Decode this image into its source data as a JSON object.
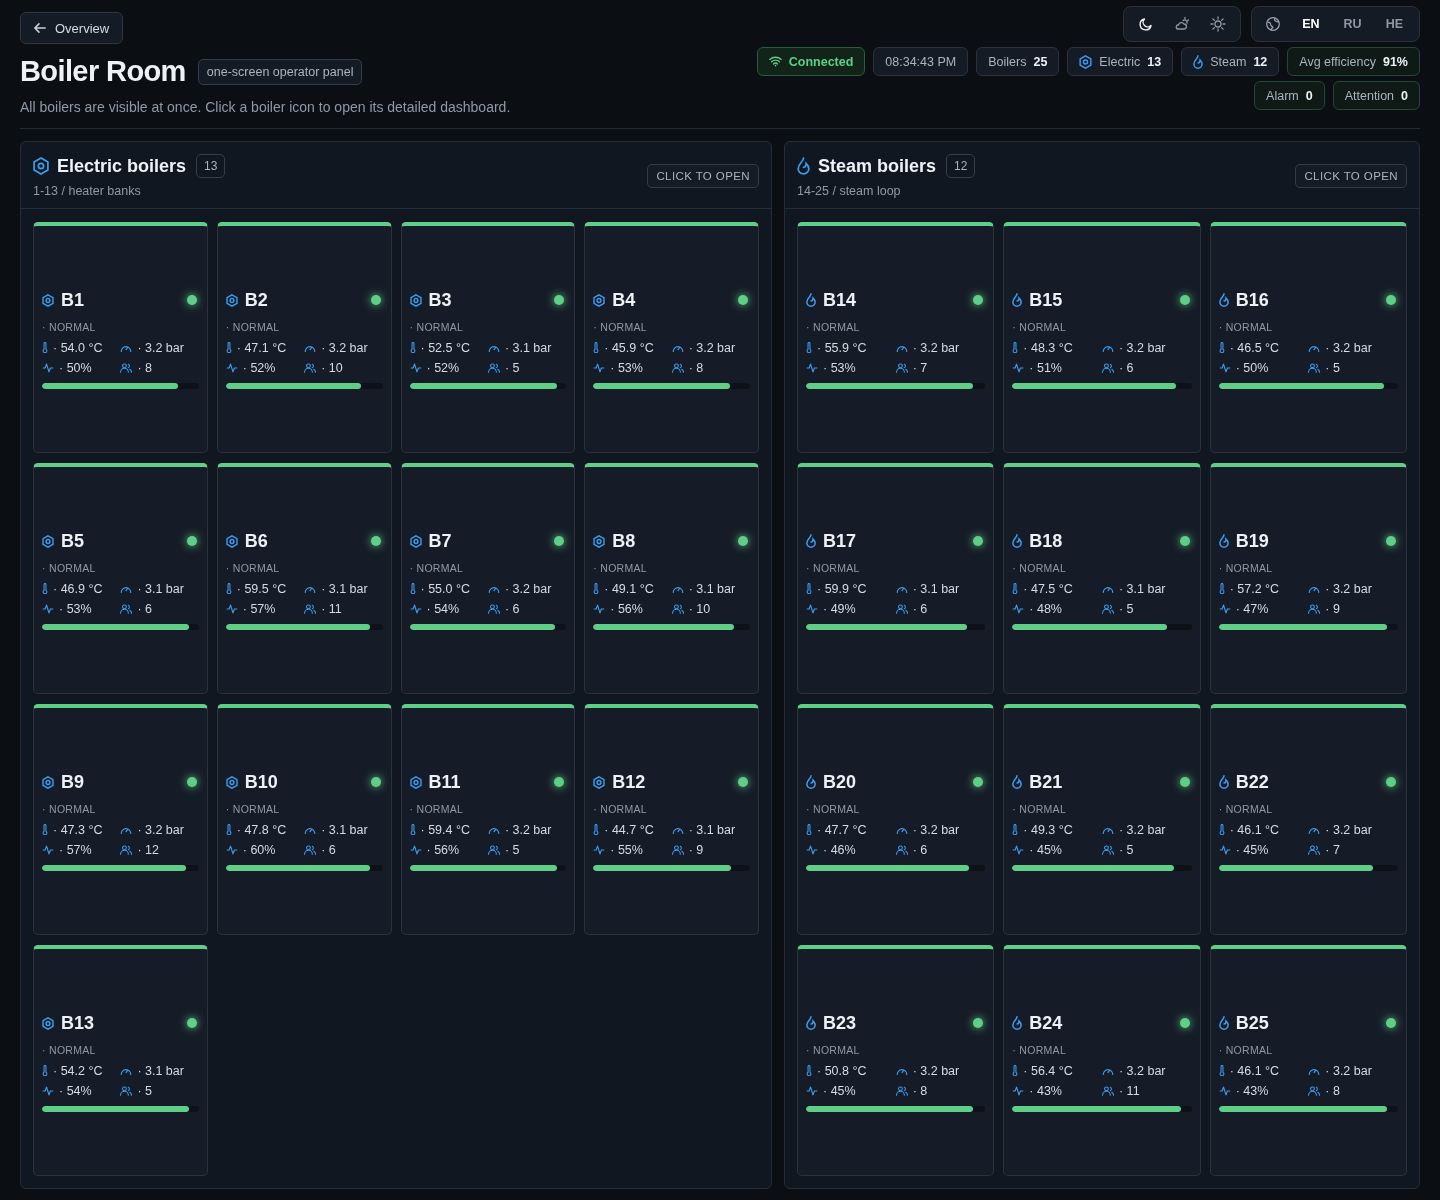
{
  "back_button": {
    "label": "Overview"
  },
  "title": "Boiler Room",
  "title_tag": "one-screen operator panel",
  "subtitle": "All boilers are visible at once. Click a boiler icon to open its detailed dashboard.",
  "stats": [
    {
      "kind": "connection",
      "label": "Connected"
    },
    {
      "kind": "clock",
      "label": "08:34:43 PM"
    },
    {
      "kind": "total",
      "label": "Boilers",
      "value": "25"
    },
    {
      "kind": "electric",
      "label": "Electric",
      "value": "13"
    },
    {
      "kind": "steam",
      "label": "Steam",
      "value": "12"
    },
    {
      "kind": "efficiency",
      "label": "Avg efficiency",
      "value": "91%"
    }
  ],
  "alerts": [
    {
      "label": "Alarm",
      "value": "0"
    },
    {
      "label": "Attention",
      "value": "0"
    }
  ],
  "themes": [
    {
      "kind": "dark",
      "selected": true
    },
    {
      "kind": "auto",
      "selected": false
    },
    {
      "kind": "light",
      "selected": false
    }
  ],
  "languages": [
    {
      "label": "EN",
      "selected": true
    },
    {
      "label": "RU",
      "selected": false
    },
    {
      "label": "HE",
      "selected": false
    }
  ],
  "sections": [
    {
      "kind": "electric",
      "title": "Electric boilers",
      "count": "13",
      "subtitle": "1-13 / heater banks",
      "open_button": "CLICK TO OPEN",
      "boilers": [
        {
          "name": "B1",
          "status": "· NORMAL",
          "temp": "· 54.0 °C",
          "pressure": "· 3.2 bar",
          "efficiency": "· 50%",
          "crew": "· 8",
          "level": 0.87
        },
        {
          "name": "B2",
          "status": "· NORMAL",
          "temp": "· 47.1 °C",
          "pressure": "· 3.2 bar",
          "efficiency": "· 52%",
          "crew": "· 10",
          "level": 0.86
        },
        {
          "name": "B3",
          "status": "· NORMAL",
          "temp": "· 52.5 °C",
          "pressure": "· 3.1 bar",
          "efficiency": "· 52%",
          "crew": "· 5",
          "level": 0.94
        },
        {
          "name": "B4",
          "status": "· NORMAL",
          "temp": "· 45.9 °C",
          "pressure": "· 3.2 bar",
          "efficiency": "· 53%",
          "crew": "· 8",
          "level": 0.87
        },
        {
          "name": "B5",
          "status": "· NORMAL",
          "temp": "· 46.9 °C",
          "pressure": "· 3.1 bar",
          "efficiency": "· 53%",
          "crew": "· 6",
          "level": 0.94
        },
        {
          "name": "B6",
          "status": "· NORMAL",
          "temp": "· 59.5 °C",
          "pressure": "· 3.1 bar",
          "efficiency": "· 57%",
          "crew": "· 11",
          "level": 0.92
        },
        {
          "name": "B7",
          "status": "· NORMAL",
          "temp": "· 55.0 °C",
          "pressure": "· 3.2 bar",
          "efficiency": "· 54%",
          "crew": "· 6",
          "level": 0.93
        },
        {
          "name": "B8",
          "status": "· NORMAL",
          "temp": "· 49.1 °C",
          "pressure": "· 3.1 bar",
          "efficiency": "· 56%",
          "crew": "· 10",
          "level": 0.9
        },
        {
          "name": "B9",
          "status": "· NORMAL",
          "temp": "· 47.3 °C",
          "pressure": "· 3.2 bar",
          "efficiency": "· 57%",
          "crew": "· 12",
          "level": 0.92
        },
        {
          "name": "B10",
          "status": "· NORMAL",
          "temp": "· 47.8 °C",
          "pressure": "· 3.1 bar",
          "efficiency": "· 60%",
          "crew": "· 6",
          "level": 0.92
        },
        {
          "name": "B11",
          "status": "· NORMAL",
          "temp": "· 59.4 °C",
          "pressure": "· 3.2 bar",
          "efficiency": "· 56%",
          "crew": "· 5",
          "level": 0.94
        },
        {
          "name": "B12",
          "status": "· NORMAL",
          "temp": "· 44.7 °C",
          "pressure": "· 3.1 bar",
          "efficiency": "· 55%",
          "crew": "· 9",
          "level": 0.88
        },
        {
          "name": "B13",
          "status": "· NORMAL",
          "temp": "· 54.2 °C",
          "pressure": "· 3.1 bar",
          "efficiency": "· 54%",
          "crew": "· 5",
          "level": 0.94
        }
      ]
    },
    {
      "kind": "steam",
      "title": "Steam boilers",
      "count": "12",
      "subtitle": "14-25 / steam loop",
      "open_button": "CLICK TO OPEN",
      "boilers": [
        {
          "name": "B14",
          "status": "· NORMAL",
          "temp": "· 55.9 °C",
          "pressure": "· 3.2 bar",
          "efficiency": "· 53%",
          "crew": "· 7",
          "level": 0.93
        },
        {
          "name": "B15",
          "status": "· NORMAL",
          "temp": "· 48.3 °C",
          "pressure": "· 3.2 bar",
          "efficiency": "· 51%",
          "crew": "· 6",
          "level": 0.91
        },
        {
          "name": "B16",
          "status": "· NORMAL",
          "temp": "· 46.5 °C",
          "pressure": "· 3.2 bar",
          "efficiency": "· 50%",
          "crew": "· 5",
          "level": 0.92
        },
        {
          "name": "B17",
          "status": "· NORMAL",
          "temp": "· 59.9 °C",
          "pressure": "· 3.1 bar",
          "efficiency": "· 49%",
          "crew": "· 6",
          "level": 0.9
        },
        {
          "name": "B18",
          "status": "· NORMAL",
          "temp": "· 47.5 °C",
          "pressure": "· 3.1 bar",
          "efficiency": "· 48%",
          "crew": "· 5",
          "level": 0.86
        },
        {
          "name": "B19",
          "status": "· NORMAL",
          "temp": "· 57.2 °C",
          "pressure": "· 3.2 bar",
          "efficiency": "· 47%",
          "crew": "· 9",
          "level": 0.94
        },
        {
          "name": "B20",
          "status": "· NORMAL",
          "temp": "· 47.7 °C",
          "pressure": "· 3.2 bar",
          "efficiency": "· 46%",
          "crew": "· 6",
          "level": 0.91
        },
        {
          "name": "B21",
          "status": "· NORMAL",
          "temp": "· 49.3 °C",
          "pressure": "· 3.2 bar",
          "efficiency": "· 45%",
          "crew": "· 5",
          "level": 0.9
        },
        {
          "name": "B22",
          "status": "· NORMAL",
          "temp": "· 46.1 °C",
          "pressure": "· 3.2 bar",
          "efficiency": "· 45%",
          "crew": "· 7",
          "level": 0.86
        },
        {
          "name": "B23",
          "status": "· NORMAL",
          "temp": "· 50.8 °C",
          "pressure": "· 3.2 bar",
          "efficiency": "· 45%",
          "crew": "· 8",
          "level": 0.93
        },
        {
          "name": "B24",
          "status": "· NORMAL",
          "temp": "· 56.4 °C",
          "pressure": "· 3.2 bar",
          "efficiency": "· 43%",
          "crew": "· 11",
          "level": 0.94
        },
        {
          "name": "B25",
          "status": "· NORMAL",
          "temp": "· 46.1 °C",
          "pressure": "· 3.2 bar",
          "efficiency": "· 43%",
          "crew": "· 8",
          "level": 0.94
        }
      ]
    }
  ]
}
